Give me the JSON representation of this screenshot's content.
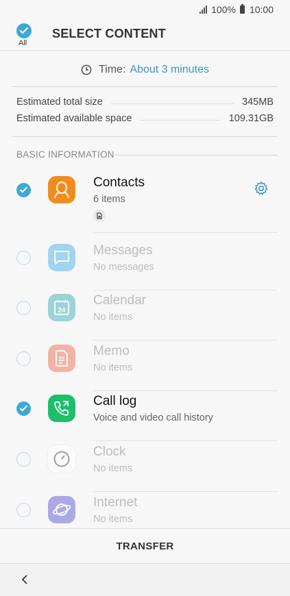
{
  "status_bar": {
    "battery": "100%",
    "time": "10:00"
  },
  "header": {
    "select_all_label": "All",
    "title": "SELECT CONTENT"
  },
  "time_estimate": {
    "label": "Time:",
    "value": "About 3 minutes"
  },
  "storage": {
    "total_label": "Estimated total size",
    "total_value": "345MB",
    "available_label": "Estimated available space",
    "available_value": "109.31GB"
  },
  "section": {
    "title": "BASIC INFORMATION"
  },
  "items": [
    {
      "name": "Contacts",
      "sub": "6 items",
      "checked": true,
      "icon": "contacts-icon",
      "color": "#f28b1d"
    },
    {
      "name": "Messages",
      "sub": "No messages",
      "checked": false,
      "icon": "messages-icon",
      "color": "#5cb8f0"
    },
    {
      "name": "Calendar",
      "sub": "No items",
      "checked": false,
      "icon": "calendar-icon",
      "color": "#4fb6c4"
    },
    {
      "name": "Memo",
      "sub": "No items",
      "checked": false,
      "icon": "memo-icon",
      "color": "#ee7d63"
    },
    {
      "name": "Call log",
      "sub": "Voice and video call history",
      "checked": true,
      "icon": "call-log-icon",
      "color": "#1dbf6b"
    },
    {
      "name": "Clock",
      "sub": "No items",
      "checked": false,
      "icon": "clock-icon",
      "color": "#ffffff"
    },
    {
      "name": "Internet",
      "sub": "No items",
      "checked": false,
      "icon": "internet-icon",
      "color": "#6d6bd8"
    }
  ],
  "footer": {
    "transfer_label": "TRANSFER"
  },
  "colors": {
    "accent": "#3da9d6",
    "time_value": "#3a96c5"
  }
}
